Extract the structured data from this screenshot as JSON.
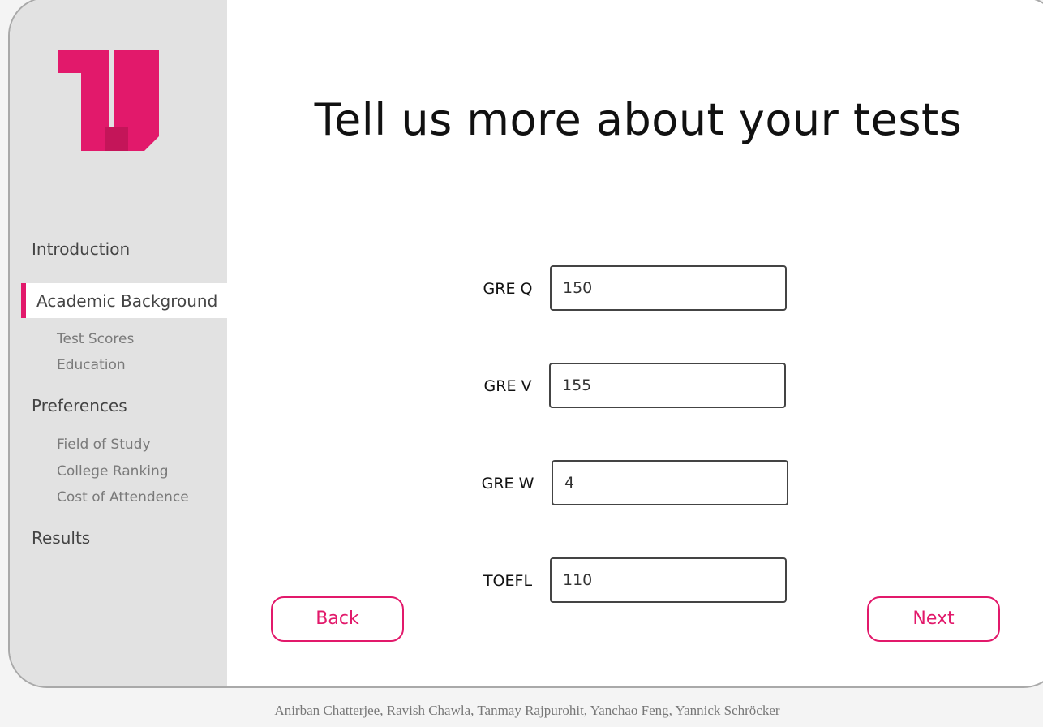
{
  "colors": {
    "accent": "#e2196b",
    "sidebar_bg": "#e2e2e2"
  },
  "brand": {
    "logo_icon": "u-logo-icon"
  },
  "sidebar": {
    "introduction": "Introduction",
    "academic_background": "Academic Background",
    "academic_sub": [
      "Test Scores",
      "Education"
    ],
    "preferences": "Preferences",
    "preferences_sub": [
      "Field of Study",
      "College Ranking",
      "Cost of Attendence"
    ],
    "results": "Results"
  },
  "main": {
    "title": "Tell us more about your tests",
    "fields": [
      {
        "label": "GRE Q",
        "value": "150"
      },
      {
        "label": "GRE V",
        "value": "155"
      },
      {
        "label": "GRE W",
        "value": "4"
      },
      {
        "label": "TOEFL",
        "value": "110"
      }
    ],
    "back_label": "Back",
    "next_label": "Next"
  },
  "footer": {
    "authors": "Anirban Chatterjee, Ravish Chawla, Tanmay Rajpurohit, Yanchao Feng, Yannick Schröcker"
  }
}
